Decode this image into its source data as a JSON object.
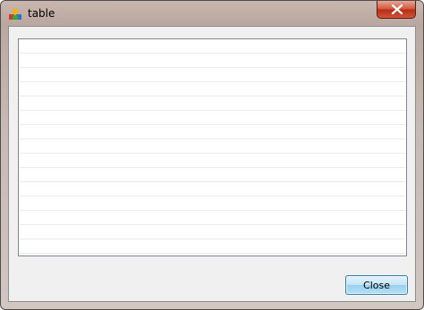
{
  "window": {
    "title": "table",
    "icon": "app-cube-icon",
    "close_icon": "close-x-icon"
  },
  "table": {
    "rows": [
      "",
      "",
      "",
      "",
      "",
      "",
      "",
      "",
      "",
      "",
      "",
      "",
      "",
      "",
      ""
    ]
  },
  "buttons": {
    "close_label": "Close"
  },
  "colors": {
    "close_button_red": "#c8442a",
    "button_accent": "#3c7fb1"
  }
}
